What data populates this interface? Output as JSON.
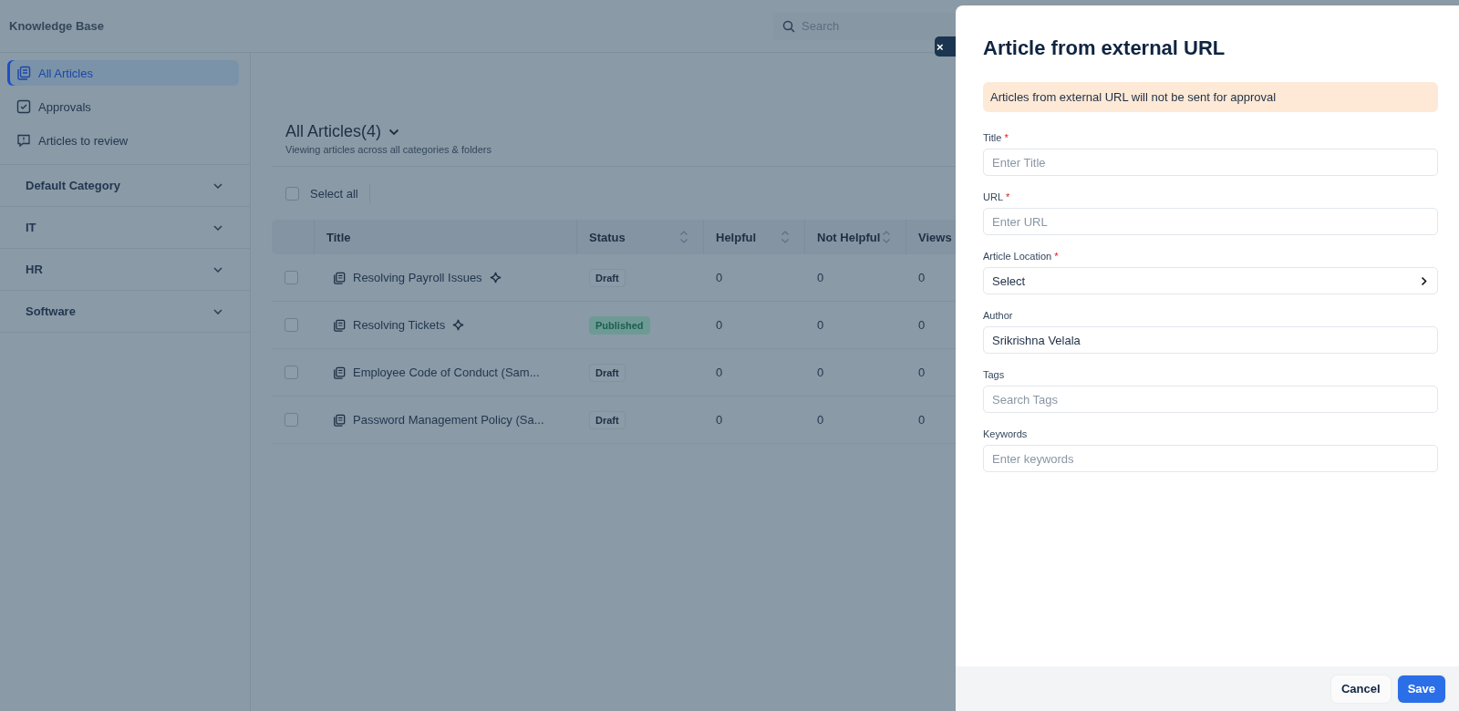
{
  "app": {
    "title": "Knowledge Base",
    "search": {
      "placeholder": "Search"
    }
  },
  "sidebar": {
    "items": [
      {
        "label": "All Articles",
        "kind": "articles",
        "selected": true
      },
      {
        "label": "Approvals",
        "kind": "approvals",
        "selected": false
      },
      {
        "label": "Articles to review",
        "kind": "review",
        "selected": false
      }
    ],
    "categories": [
      {
        "label": "Default Category",
        "expanded": false
      },
      {
        "label": "IT",
        "expanded": false
      },
      {
        "label": "HR",
        "expanded": false
      },
      {
        "label": "Software",
        "expanded": false
      }
    ]
  },
  "main": {
    "title": "All Articles(4)",
    "subtitle": "Viewing articles across all categories & folders",
    "select_all": {
      "label": "Select all",
      "checked": false
    },
    "table": {
      "columns": [
        {
          "label": "Title",
          "sortable": false
        },
        {
          "label": "Status",
          "sortable": true
        },
        {
          "label": "Helpful",
          "sortable": true
        },
        {
          "label": "Not Helpful",
          "sortable": true
        },
        {
          "label": "Views"
        }
      ],
      "rows": [
        {
          "checked": false,
          "title": "Resolving Payroll Issues",
          "ai": true,
          "status": "Draft",
          "kind": "draft",
          "helpful": "0",
          "not_helpful": "0",
          "views": "0"
        },
        {
          "checked": false,
          "title": "Resolving Tickets",
          "ai": true,
          "status": "Published",
          "kind": "published",
          "helpful": "0",
          "not_helpful": "0",
          "views": "0"
        },
        {
          "checked": false,
          "title": "Employee Code of Conduct (Sam...",
          "ai": false,
          "status": "Draft",
          "kind": "draft",
          "helpful": "0",
          "not_helpful": "0",
          "views": "0"
        },
        {
          "checked": false,
          "title": "Password Management Policy (Sa...",
          "ai": false,
          "status": "Draft",
          "kind": "draft",
          "helpful": "0",
          "not_helpful": "0",
          "views": "0"
        }
      ]
    }
  },
  "panel": {
    "close": "×",
    "title": "Article from external URL",
    "notice": "Articles from external URL will not be sent for approval",
    "fields": [
      {
        "label": "Title",
        "required_mark": "*",
        "kind": "text",
        "placeholder": "Enter Title"
      },
      {
        "label": "URL",
        "required_mark": "*",
        "kind": "text",
        "placeholder": "Enter URL"
      },
      {
        "label": "Article Location",
        "required_mark": "*",
        "kind": "select",
        "value": "Select"
      },
      {
        "label": "Author",
        "kind": "text",
        "value": "Srikrishna Velala"
      },
      {
        "label": "Tags",
        "kind": "text",
        "placeholder": "Search Tags"
      },
      {
        "label": "Keywords",
        "kind": "text",
        "placeholder": "Enter keywords"
      }
    ],
    "buttons": [
      {
        "label": "Cancel",
        "kind": "secondary"
      },
      {
        "label": "Save",
        "kind": "primary"
      }
    ]
  }
}
